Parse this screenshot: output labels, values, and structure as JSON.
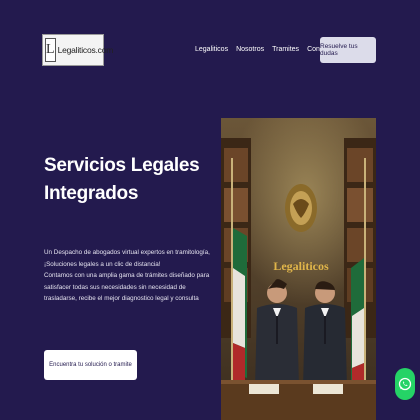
{
  "brand": {
    "logo_text": "Legaliticos.com",
    "logo_mark": "L"
  },
  "nav": {
    "items": [
      "Legaliticos",
      "Nosotros",
      "Tramites",
      "Contacto"
    ],
    "cta": "Resuelve tus dudas"
  },
  "hero": {
    "title_line1": "Servicios Legales",
    "title_line2": "Integrados",
    "paragraph": [
      "Un Despacho de abogados virtual expertos en tramitología,",
      "¡Soluciones legales a un clic de distancia!",
      "Contamos con una amplia gama de trámites diseñado para",
      "satisfacer todas sus necesidades sin necesidad de",
      "trasladarse, recibe el mejor diagnostico legal y consulta"
    ],
    "cta": "Encuentra tu solución o tramite"
  },
  "photo": {
    "sign_text": "Legaliticos"
  },
  "floating": {
    "icon": "whatsapp-icon"
  },
  "colors": {
    "background": "#231a4e",
    "cta_bg": "#dcdcea",
    "whatsapp": "#25d366"
  }
}
